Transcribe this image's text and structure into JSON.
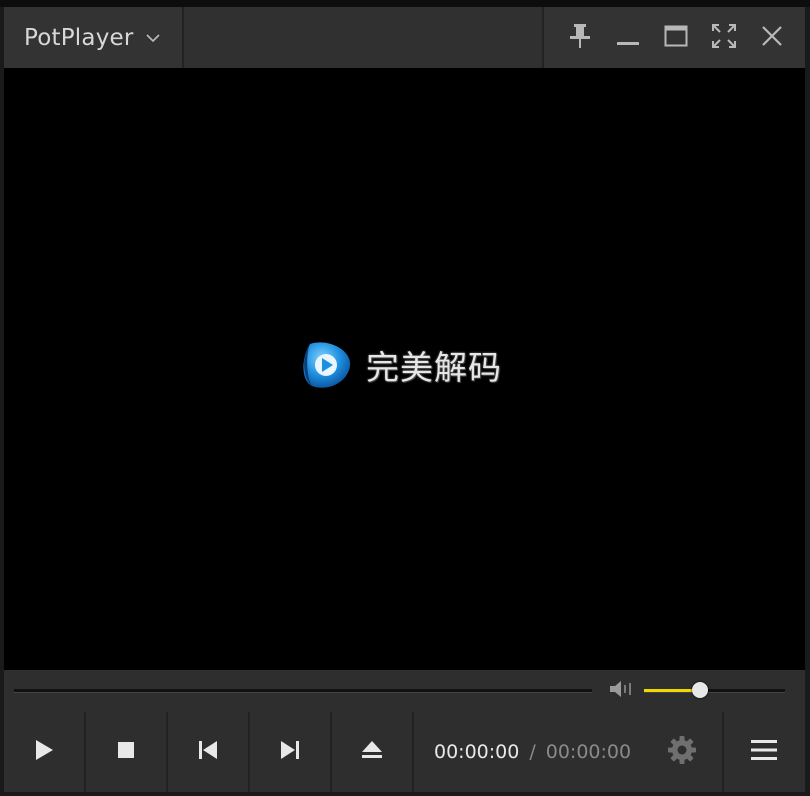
{
  "app": {
    "name": "PotPlayer"
  },
  "title_bar": {
    "brand_label": "PotPlayer",
    "brand_menu_icon": "chevron-down-icon",
    "controls": [
      {
        "name": "pin-button",
        "icon": "pin-icon"
      },
      {
        "name": "minimize-button",
        "icon": "minimize-icon"
      },
      {
        "name": "maximize-button",
        "icon": "maximize-icon"
      },
      {
        "name": "fullscreen-button",
        "icon": "fullscreen-icon"
      },
      {
        "name": "close-button",
        "icon": "close-icon"
      }
    ]
  },
  "video": {
    "codec_badge_text": "完美解码",
    "codec_logo_icon": "play-logo-icon",
    "background_color": "#000000"
  },
  "seekbar": {
    "position_fraction": 0
  },
  "volume": {
    "icon": "speaker-icon",
    "level_fraction": 0.4,
    "fill_color": "#f0d800"
  },
  "controls": {
    "play_icon": "play-icon",
    "stop_icon": "stop-icon",
    "previous_icon": "skip-previous-icon",
    "next_icon": "skip-next-icon",
    "eject_icon": "eject-icon",
    "settings_icon": "gear-icon",
    "menu_icon": "hamburger-menu-icon"
  },
  "time": {
    "current": "00:00:00",
    "separator": "/",
    "total": "00:00:00"
  }
}
